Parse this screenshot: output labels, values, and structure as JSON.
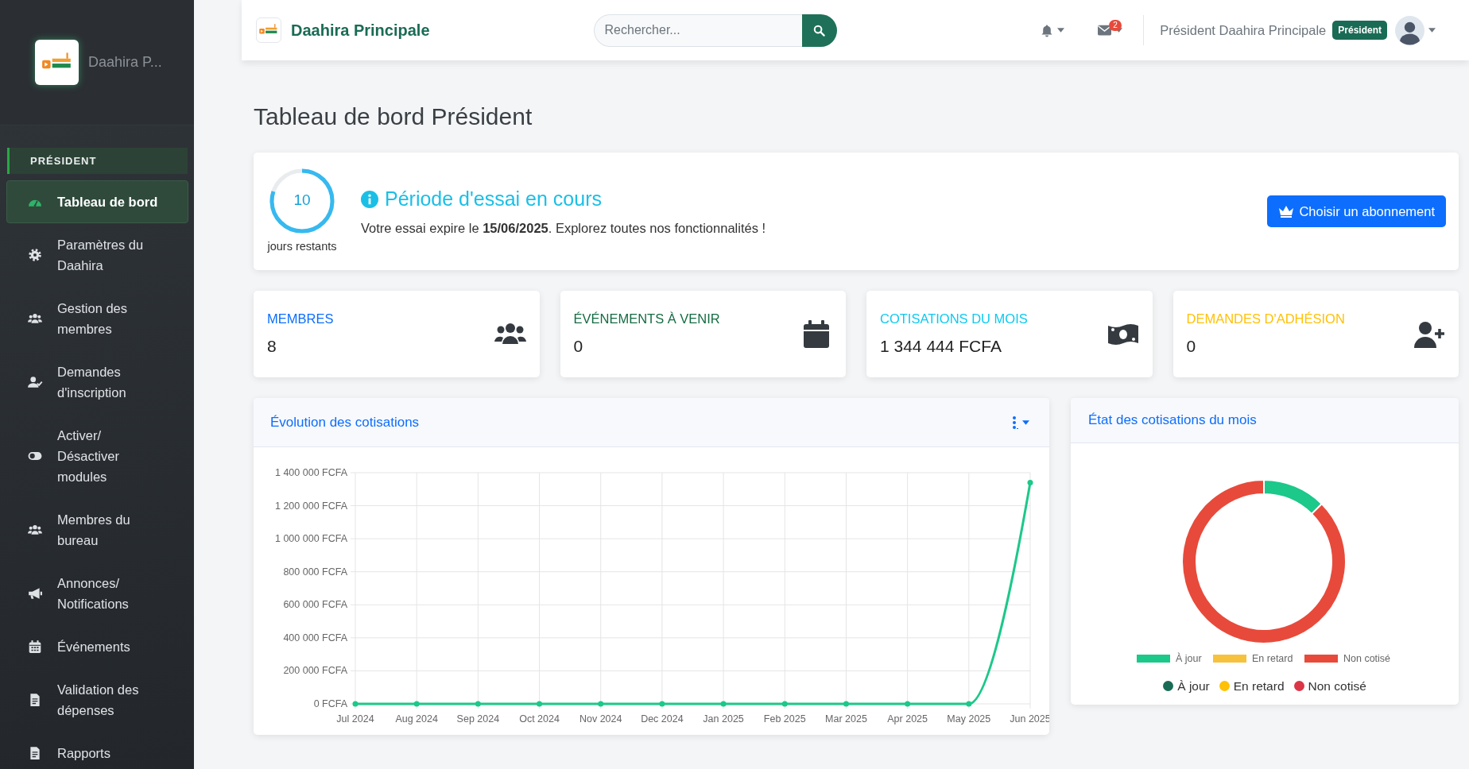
{
  "sidebar": {
    "brand": "Daahira P...",
    "section": "PRÉSIDENT",
    "items": [
      {
        "label": "Tableau de bord",
        "selected": true
      },
      {
        "label": "Paramètres du Daahira",
        "selected": false
      },
      {
        "label": "Gestion des membres",
        "selected": false
      },
      {
        "label": "Demandes d'inscription",
        "selected": false
      },
      {
        "label": "Activer/ Désactiver modules",
        "selected": false
      },
      {
        "label": "Membres du bureau",
        "selected": false
      },
      {
        "label": "Annonces/ Notifications",
        "selected": false
      },
      {
        "label": "Événements",
        "selected": false
      },
      {
        "label": "Validation des dépenses",
        "selected": false
      },
      {
        "label": "Rapports",
        "selected": false
      }
    ]
  },
  "header": {
    "brand": "Daahira Principale",
    "search": {
      "placeholder": "Rechercher..."
    },
    "messages_badge": "2",
    "user_name": "Président Daahira Principale",
    "role_badge": "Président"
  },
  "page_title": "Tableau de bord Président",
  "trial": {
    "days": "10",
    "level": 0.8,
    "days_label": "jours restants",
    "title": "Période d'essai en cours",
    "message": "Votre essai expire le **15/06/2025**. Explorez toutes nos fonctionnalités !",
    "button": "Choisir un abonnement"
  },
  "stats": [
    {
      "label": "MEMBRES",
      "value": "8",
      "color": "#0d6efd"
    },
    {
      "label": "ÉVÉNEMENTS À VENIR",
      "value": "0",
      "color": "#146c43"
    },
    {
      "label": "COTISATIONS DU MOIS",
      "value": "1 344 444 FCFA",
      "color": "#0dcaf0"
    },
    {
      "label": "DEMANDES D'ADHÉSION",
      "value": "0",
      "color": "#ffc107"
    }
  ],
  "line_chart": {
    "title": "Évolution des cotisations",
    "chart_data": {
      "type": "line",
      "categories": [
        "Jul 2024",
        "Aug 2024",
        "Sep 2024",
        "Oct 2024",
        "Nov 2024",
        "Dec 2024",
        "Jan 2025",
        "Feb 2025",
        "Mar 2025",
        "Apr 2025",
        "May 2025",
        "Jun 2025"
      ],
      "grid": true,
      "series": [
        {
          "color": "#1cc88a",
          "marker": true,
          "values": [
            0,
            0,
            0,
            0,
            0,
            0,
            0,
            0,
            0,
            0,
            0,
            1340000
          ]
        }
      ],
      "ylim": [
        0,
        1400000
      ],
      "yticks": [
        {
          "value": 0,
          "label": "0 FCFA"
        },
        {
          "value": 200000,
          "label": "200 000 FCFA"
        },
        {
          "value": 400000,
          "label": "400 000 FCFA"
        },
        {
          "value": 600000,
          "label": "600 000 FCFA"
        },
        {
          "value": 800000,
          "label": "800 000 FCFA"
        },
        {
          "value": 1000000,
          "label": "1 000 000 FCFA"
        },
        {
          "value": 1200000,
          "label": "1 200 000 FCFA"
        },
        {
          "value": 1400000,
          "label": "1 400 000 FCFA"
        }
      ]
    }
  },
  "donut_chart": {
    "title": "État des cotisations du mois",
    "chart_data": {
      "type": "donut",
      "categories": [
        "À jour",
        "En retard",
        "Non cotisé"
      ],
      "values": [
        12.5,
        0,
        87.5
      ],
      "legend": "bottom",
      "colors": [
        "#1cc88a",
        "#f6c23e",
        "#e74a3b"
      ]
    },
    "legend": [
      {
        "label": "À jour",
        "color": "#1a6b55"
      },
      {
        "label": "En retard",
        "color": "#ffc107"
      },
      {
        "label": "Non cotisé",
        "color": "#dc3545"
      }
    ]
  }
}
